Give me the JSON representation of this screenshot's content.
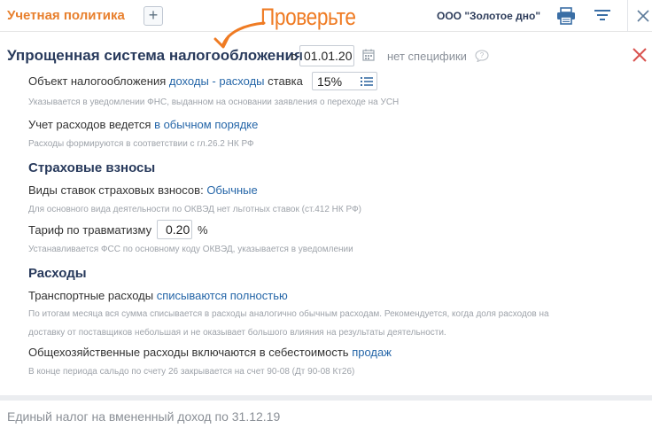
{
  "topbar": {
    "title": "Учетная политика",
    "add_label": "+",
    "org_name": "ООО \"Золотое дно\"",
    "print_icon": "printer-icon",
    "filter_icon": "list-filter-icon",
    "close_icon": "close-icon"
  },
  "annotation": {
    "text": "Проверьте",
    "color": "#ef7b23"
  },
  "section": {
    "title": "Упрощенная система налогообложения",
    "since_label": "с",
    "date_value": "01.01.20",
    "no_spec": "нет специфики"
  },
  "object": {
    "label": "Объект налогообложения",
    "value": "доходы - расходы",
    "rate_label": "ставка",
    "rate_value": "15%",
    "hint": "Указывается в уведомлении ФНС, выданном на основании заявления о переходе на УСН"
  },
  "expense_accounting": {
    "label": "Учет расходов ведется",
    "value": "в обычном порядке",
    "hint": "Расходы формируются в соответствии с гл.26.2 НК РФ"
  },
  "insurance": {
    "title": "Страховые взносы",
    "rate_types_label": "Виды ставок страховых взносов:",
    "rate_types_value": "Обычные",
    "rate_types_hint": "Для основного вида деятельности по ОКВЭД нет льготных ставок (ст.412 НК РФ)",
    "injury_label": "Тариф по травматизму",
    "injury_value": "0.20",
    "injury_unit": "%",
    "injury_hint": "Устанавливается ФСС по основному коду ОКВЭД, указывается в уведомлении"
  },
  "expenses": {
    "title": "Расходы",
    "transport_label": "Транспортные расходы",
    "transport_value": "списываются полностью",
    "transport_hint_1": "По итогам месяца вся сумма списывается в расходы аналогично обычным расходам. Рекомендуется, когда доля расходов на",
    "transport_hint_2": "доставку от поставщиков небольшая и не оказывает большого влияния на результаты деятельности.",
    "general_label": "Общехозяйственные расходы включаются в себестоимость",
    "general_value": "продаж",
    "general_hint": "В конце периода сальдо по счету 26 закрывается на счет 90-08 (Дт 90-08 Кт26)"
  },
  "footer": {
    "next_section": "Единый налог на вмененный доход по 31.12.19"
  },
  "colors": {
    "accent": "#e8802e",
    "link": "#2566a8",
    "heading": "#283a5c",
    "delete": "#d9534f"
  }
}
